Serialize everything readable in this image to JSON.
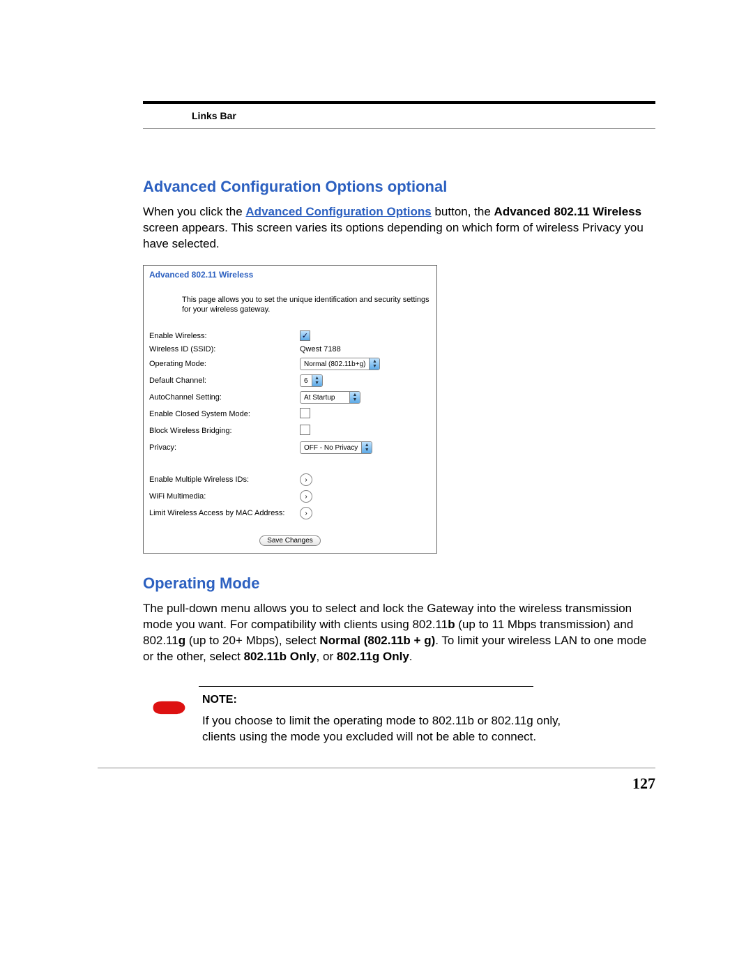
{
  "header": {
    "section_label": "Links Bar"
  },
  "section1": {
    "heading": "Advanced Configuration Options optional",
    "prefix": "When you click the ",
    "link_text": "Advanced Configuration Options",
    "mid1": " button, the ",
    "bold1": "Advanced 802.11 Wireless",
    "suffix": " screen appears. This screen varies its options depending on which form of wireless Privacy you have selected."
  },
  "panel": {
    "title": "Advanced 802.11 Wireless",
    "description": "This page allows you to set the unique identification and security settings for your wireless gateway.",
    "rows": {
      "enable_wireless": "Enable Wireless:",
      "wireless_id": "Wireless ID (SSID):",
      "wireless_id_value": "Qwest 7188",
      "operating_mode": "Operating Mode:",
      "operating_mode_value": "Normal (802.11b+g)",
      "default_channel": "Default Channel:",
      "default_channel_value": "6",
      "autochannel": "AutoChannel Setting:",
      "autochannel_value": "At Startup",
      "closed_system": "Enable Closed System Mode:",
      "block_bridging": "Block Wireless Bridging:",
      "privacy": "Privacy:",
      "privacy_value": "OFF - No Privacy",
      "multiple_ids": "Enable Multiple Wireless IDs:",
      "wifi_mm": "WiFi Multimedia:",
      "mac_limit": "Limit Wireless Access by MAC Address:"
    },
    "save_button": "Save Changes"
  },
  "section2": {
    "heading": "Operating Mode",
    "p_pre": "The pull-down menu allows you to select and lock the Gateway into the wireless transmission mode you want. For compatibility with clients using 802.11",
    "b1": "b",
    "p_mid1": " (up to 11 Mbps transmission) and 802.11",
    "b2": "g",
    "p_mid2": " (up to 20+ Mbps), select ",
    "b3": "Normal (802.11b + g)",
    "p_mid3": ". To limit your wireless LAN to one mode or the other, select ",
    "b4": "802.11b Only",
    "p_mid4": ", or ",
    "b5": "802.11g Only",
    "p_end": "."
  },
  "note": {
    "heading": "NOTE:",
    "text": "If you choose to limit the operating mode to 802.11b or 802.11g only, clients using the mode you excluded will not be able to connect."
  },
  "page_number": "127"
}
